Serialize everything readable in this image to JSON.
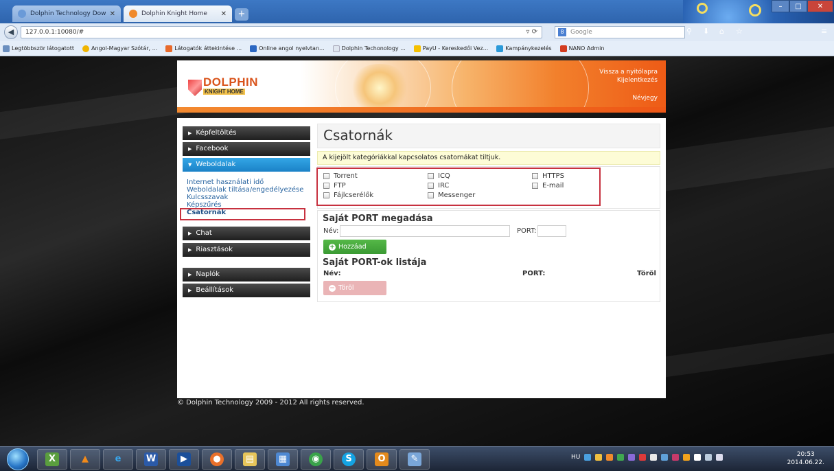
{
  "browser": {
    "tabs": [
      {
        "label": "Dolphin Technology Down..."
      },
      {
        "label": "Dolphin Knight Home"
      }
    ],
    "url": "127.0.0.1:10080/#",
    "search_placeholder": "Google",
    "bookmarks": [
      "Legtöbbször látogatott",
      "Angol-Magyar Szótár, ...",
      "Látogatók áttekintése ...",
      "Online angol nyelvtan...",
      "Dolphin Techonology ...",
      "PayU - Kereskedői Vez...",
      "Kampánykezelés",
      "NANO Admin"
    ]
  },
  "header": {
    "brand_top": "DOLPHIN",
    "brand_bottom": "KNIGHT HOME",
    "link_home": "Vissza a nyitólapra",
    "link_logout": "Kijelentkezés",
    "link_card": "Névjegy"
  },
  "sidebar": {
    "items": [
      {
        "label": "Képfeltöltés"
      },
      {
        "label": "Facebook"
      },
      {
        "label": "Weboldalak"
      },
      {
        "label": "Chat"
      },
      {
        "label": "Riasztások"
      },
      {
        "label": "Naplók"
      },
      {
        "label": "Beállítások"
      }
    ],
    "submenu": [
      "Internet használati idő",
      "Weboldalak tiltása/engedélyezése",
      "Kulcsszavak",
      "Képszűrés",
      "Csatornák"
    ]
  },
  "main": {
    "title": "Csatornák",
    "note": "A kijejölt kategóriákkal kapcsolatos csatornákat tiltjuk.",
    "categories": [
      "Torrent",
      "FTP",
      "Fájlcserélők",
      "ICQ",
      "IRC",
      "Messenger",
      "HTTPS",
      "E-mail"
    ],
    "custom_port_heading": "Saját PORT megadása",
    "name_label": "Név:",
    "port_label": "PORT:",
    "add_button": "Hozzáad",
    "list_heading": "Saját PORT-ok listája",
    "col_name": "Név:",
    "col_port": "PORT:",
    "col_delete": "Töröl",
    "delete_button": "Töröl"
  },
  "footer": "© Dolphin Technology 2009 - 2012 All rights reserved.",
  "taskbar": {
    "lang": "HU",
    "time": "20:53",
    "date": "2014.06.22."
  }
}
